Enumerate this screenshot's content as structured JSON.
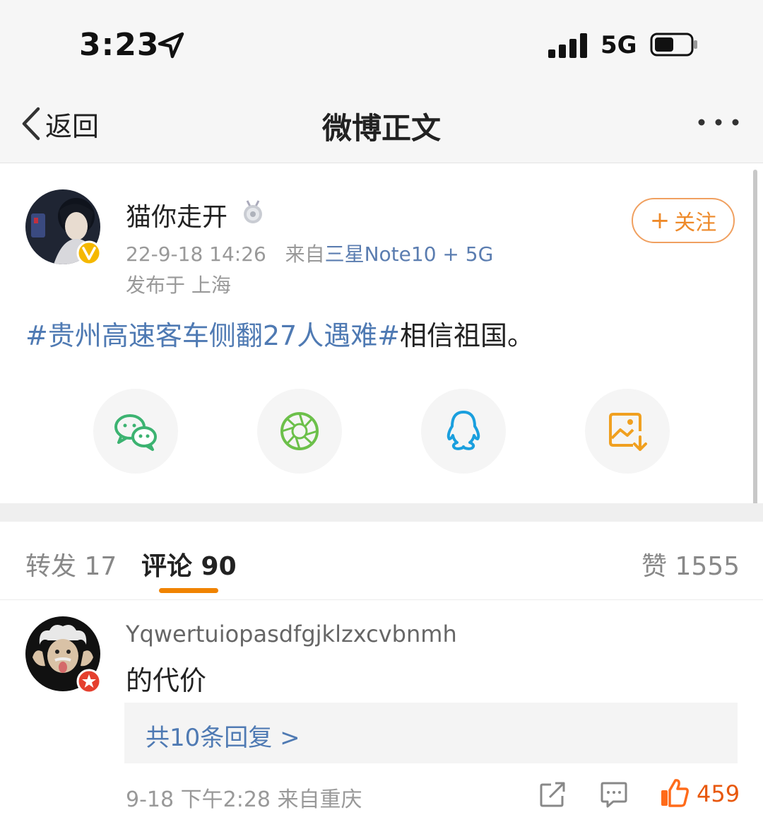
{
  "status_bar": {
    "time": "3:23",
    "network": "5G",
    "icons": [
      "location-arrow-icon",
      "signal-icon",
      "battery-icon"
    ]
  },
  "nav": {
    "back_label": "返回",
    "title": "微博正文",
    "icons": [
      "chevron-left-icon",
      "more-icon"
    ]
  },
  "post": {
    "author": "猫你走开",
    "date": "22-9-18 14:26",
    "source_prefix": "来自",
    "source": "三星Note10 + 5G",
    "location": "发布于 上海",
    "follow_label": "关注",
    "text_tag": "#贵州高速客车侧翻27人遇难#",
    "text_rest": "相信祖国。",
    "share_icons": [
      "wechat-icon",
      "moments-icon",
      "qq-icon",
      "save-image-icon"
    ]
  },
  "tabs": {
    "repost": "转发 17",
    "comments": "评论 90",
    "likes": "赞 1555"
  },
  "comment": {
    "username": "Yqwertuiopasdfgjklzxcvbnmh",
    "text": "的代价",
    "replies": "共10条回复 >",
    "meta": "9-18 下午2:28 来自重庆",
    "like_count": "459"
  },
  "colors": {
    "accent_orange": "#f08300",
    "link_blue": "#4f7ab3",
    "verified_gold": "#f5b800"
  }
}
